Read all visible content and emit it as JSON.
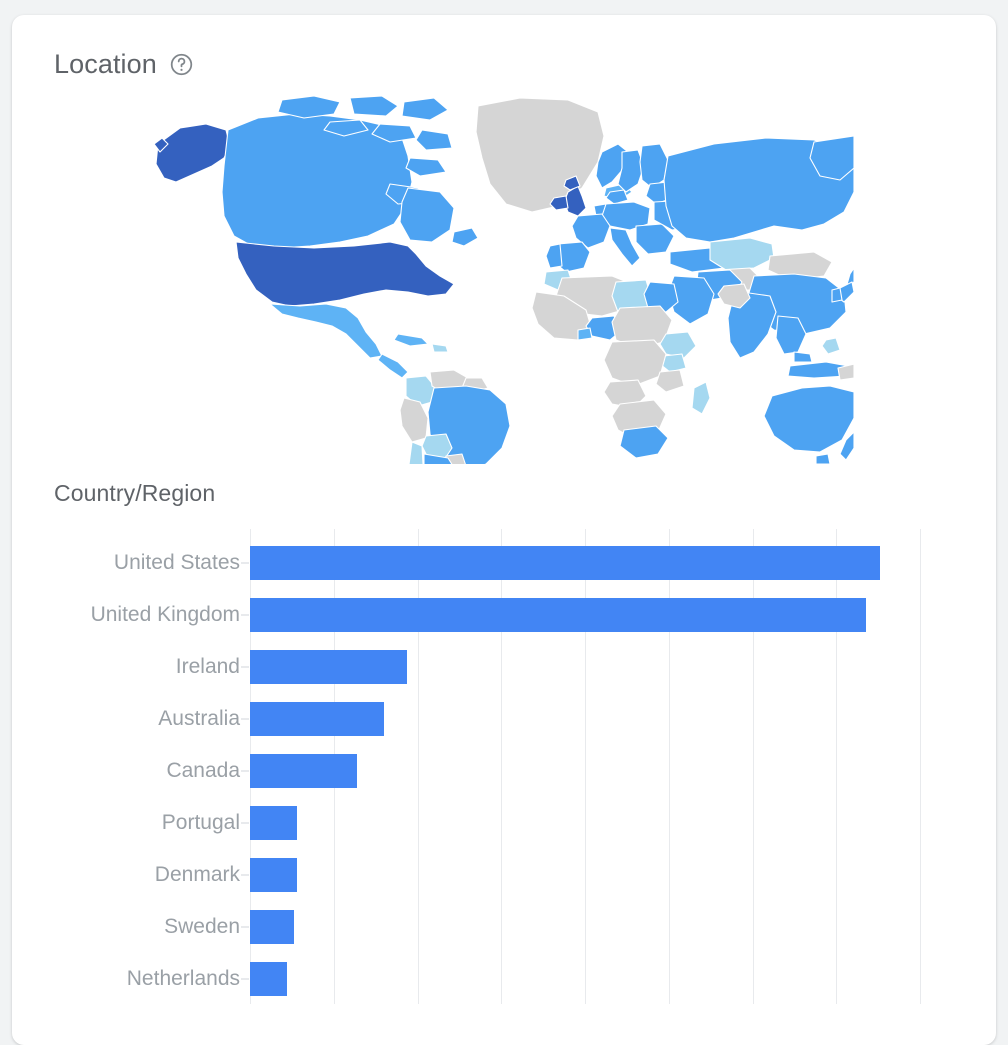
{
  "card": {
    "title": "Location",
    "help_icon": "help-circle-icon",
    "section_title": "Country/Region"
  },
  "colors": {
    "bar": "#4285f4",
    "map_tier_1": "#3461bf",
    "map_tier_2": "#4da3f2",
    "map_tier_3": "#5eb3f5",
    "map_tier_4": "#a5d8f0",
    "map_no_data": "#d5d5d5",
    "grid": "#e8eaed",
    "label_text": "#9aa0a6",
    "title_text": "#5f6368",
    "card_bg": "#ffffff",
    "page_bg": "#f1f3f4"
  },
  "chart_data": {
    "type": "bar",
    "orientation": "horizontal",
    "title": "Country/Region",
    "xlabel": "",
    "ylabel": "",
    "grid": true,
    "legend": "none",
    "categories": [
      "United States",
      "United Kingdom",
      "Ireland",
      "Australia",
      "Canada",
      "Portugal",
      "Denmark",
      "Sweden",
      "Netherlands"
    ],
    "values": [
      94,
      92,
      23.5,
      20,
      16,
      7,
      7,
      6.5,
      5.5
    ],
    "xlim": [
      0,
      100
    ],
    "gridline_values": [
      0,
      12.5,
      25,
      37.5,
      50,
      62.5,
      75,
      87.5,
      100
    ]
  },
  "map": {
    "type": "choropleth",
    "projection": "world",
    "tiers": [
      "highest",
      "high",
      "medium",
      "low",
      "no-data"
    ]
  }
}
